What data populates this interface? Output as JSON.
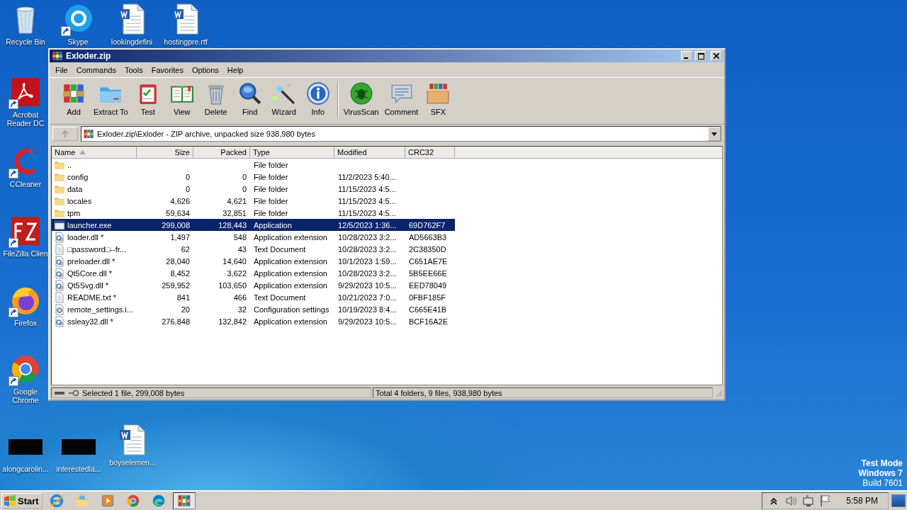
{
  "desktop": {
    "icons": [
      {
        "label": "Recycle Bin",
        "kind": "recycle",
        "shortcut": false
      },
      {
        "label": "Skype",
        "kind": "skype",
        "shortcut": true
      },
      {
        "label": "lookingdefini",
        "kind": "word",
        "shortcut": false
      },
      {
        "label": "hostingpre.rtf",
        "kind": "word",
        "shortcut": false
      },
      {
        "label": "Acrobat Reader DC",
        "kind": "acrobat",
        "shortcut": true
      },
      {
        "label": "CCleaner",
        "kind": "ccleaner",
        "shortcut": true
      },
      {
        "label": "FileZilla Clien",
        "kind": "filezilla",
        "shortcut": true
      },
      {
        "label": "Firefox",
        "kind": "firefox",
        "shortcut": true
      },
      {
        "label": "Google Chrome",
        "kind": "chrome",
        "shortcut": true
      },
      {
        "label": "alongcarolin...",
        "kind": "thumbnail",
        "shortcut": false
      },
      {
        "label": "interestedla...",
        "kind": "thumbnail",
        "shortcut": false
      },
      {
        "label": "boyselemen...",
        "kind": "word",
        "shortcut": false
      }
    ],
    "notice": [
      "Test Mode",
      "Windows 7",
      "Build 7601"
    ]
  },
  "window": {
    "title": "Exloder.zip",
    "menu": [
      "File",
      "Commands",
      "Tools",
      "Favorites",
      "Options",
      "Help"
    ],
    "toolbar_groups": [
      {
        "buttons": [
          {
            "label": "Add",
            "kind": "add"
          },
          {
            "label": "Extract To",
            "kind": "extract"
          },
          {
            "label": "Test",
            "kind": "test"
          },
          {
            "label": "View",
            "kind": "view"
          },
          {
            "label": "Delete",
            "kind": "delete"
          },
          {
            "label": "Find",
            "kind": "find"
          },
          {
            "label": "Wizard",
            "kind": "wizard"
          },
          {
            "label": "Info",
            "kind": "info"
          }
        ]
      },
      {
        "buttons": [
          {
            "label": "VirusScan",
            "kind": "virus"
          },
          {
            "label": "Comment",
            "kind": "comment"
          },
          {
            "label": "SFX",
            "kind": "sfx"
          }
        ]
      }
    ],
    "address": "Exloder.zip\\Exloder - ZIP archive, unpacked size 938,980 bytes",
    "columns": [
      {
        "label": "Name",
        "sorted": true
      },
      {
        "label": "Size",
        "sorted": false
      },
      {
        "label": "Packed",
        "sorted": false
      },
      {
        "label": "Type",
        "sorted": false
      },
      {
        "label": "Modified",
        "sorted": false
      },
      {
        "label": "CRC32",
        "sorted": false
      }
    ],
    "rows": [
      {
        "kind": "folder",
        "name": "..",
        "size": "",
        "packed": "",
        "type": "File folder",
        "modified": "",
        "crc32": "",
        "selected": false
      },
      {
        "kind": "folder",
        "name": "config",
        "size": "0",
        "packed": "0",
        "type": "File folder",
        "modified": "11/2/2023 5:40...",
        "crc32": "",
        "selected": false
      },
      {
        "kind": "folder",
        "name": "data",
        "size": "0",
        "packed": "0",
        "type": "File folder",
        "modified": "11/15/2023 4:5...",
        "crc32": "",
        "selected": false
      },
      {
        "kind": "folder",
        "name": "locales",
        "size": "4,626",
        "packed": "4,621",
        "type": "File folder",
        "modified": "11/15/2023 4:5...",
        "crc32": "",
        "selected": false
      },
      {
        "kind": "folder",
        "name": "tpm",
        "size": "59,634",
        "packed": "32,851",
        "type": "File folder",
        "modified": "11/15/2023 4:5...",
        "crc32": "",
        "selected": false
      },
      {
        "kind": "exe",
        "name": "launcher.exe",
        "size": "299,008",
        "packed": "128,443",
        "type": "Application",
        "modified": "12/5/2023 1:36...",
        "crc32": "69D762F7",
        "selected": true
      },
      {
        "kind": "dll",
        "name": "loader.dll *",
        "size": "1,497",
        "packed": "548",
        "type": "Application extension",
        "modified": "10/28/2023 3:2...",
        "crc32": "AD5663B3",
        "selected": false
      },
      {
        "kind": "txt",
        "name": "□password□--fr...",
        "size": "62",
        "packed": "43",
        "type": "Text Document",
        "modified": "10/28/2023 3:2...",
        "crc32": "2C38350D",
        "selected": false
      },
      {
        "kind": "dll",
        "name": "preloader.dll *",
        "size": "28,040",
        "packed": "14,640",
        "type": "Application extension",
        "modified": "10/1/2023 1:59...",
        "crc32": "C651AE7E",
        "selected": false
      },
      {
        "kind": "dll",
        "name": "Qt5Core.dll *",
        "size": "8,452",
        "packed": "3,622",
        "type": "Application extension",
        "modified": "10/28/2023 3:2...",
        "crc32": "5B5EE66E",
        "selected": false
      },
      {
        "kind": "dll",
        "name": "Qt5Svg.dll *",
        "size": "259,952",
        "packed": "103,650",
        "type": "Application extension",
        "modified": "9/29/2023 10:5...",
        "crc32": "EED78049",
        "selected": false
      },
      {
        "kind": "txt",
        "name": "README.txt *",
        "size": "841",
        "packed": "466",
        "type": "Text Document",
        "modified": "10/21/2023 7:0...",
        "crc32": "0FBF185F",
        "selected": false
      },
      {
        "kind": "ini",
        "name": "remote_settings.i...",
        "size": "20",
        "packed": "32",
        "type": "Configuration settings",
        "modified": "10/19/2023 8:4...",
        "crc32": "C665E41B",
        "selected": false
      },
      {
        "kind": "dll",
        "name": "ssleay32.dll *",
        "size": "276,848",
        "packed": "132,842",
        "type": "Application extension",
        "modified": "9/29/2023 10:5...",
        "crc32": "BCF16A2E",
        "selected": false
      }
    ],
    "status_left": "Selected 1 file, 299,008 bytes",
    "status_right": "Total 4 folders, 9 files, 938,980 bytes"
  },
  "taskbar": {
    "start": "Start",
    "apps": [
      {
        "kind": "ie",
        "active": false
      },
      {
        "kind": "explorer",
        "active": false
      },
      {
        "kind": "media",
        "active": false
      },
      {
        "kind": "chrome",
        "active": false
      },
      {
        "kind": "edge",
        "active": false
      },
      {
        "kind": "winrar",
        "active": true
      }
    ],
    "tray": [
      {
        "kind": "chevron"
      },
      {
        "kind": "speaker"
      },
      {
        "kind": "network"
      },
      {
        "kind": "flag"
      }
    ],
    "clock": "5:58 PM"
  }
}
